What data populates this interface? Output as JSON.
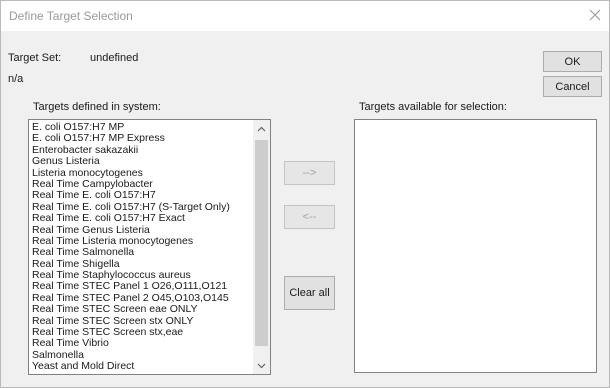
{
  "dialog": {
    "title": "Define Target Selection",
    "close_icon": "close-icon"
  },
  "target_set": {
    "label": "Target Set:",
    "value": "undefined",
    "description": "n/a"
  },
  "buttons": {
    "ok": "OK",
    "cancel": "Cancel",
    "add": "-->",
    "remove": "<--",
    "clear_all": "Clear all"
  },
  "system_list": {
    "heading": "Targets defined in system:",
    "items": [
      "E. coli O157:H7 MP",
      "E. coli O157:H7 MP Express",
      "Enterobacter sakazakii",
      "Genus Listeria",
      "Listeria monocytogenes",
      "Real Time Campylobacter",
      "Real Time E. coli O157:H7",
      "Real Time E. coli O157:H7 (S-Target Only)",
      "Real Time E. coli O157:H7 Exact",
      "Real Time Genus Listeria",
      "Real Time Listeria monocytogenes",
      "Real Time Salmonella",
      "Real Time Shigella",
      "Real Time Staphylococcus aureus",
      "Real Time STEC Panel 1 O26,O111,O121",
      "Real Time STEC Panel 2 O45,O103,O145",
      "Real Time STEC Screen eae ONLY",
      "Real Time STEC Screen stx ONLY",
      "Real Time STEC Screen stx,eae",
      "Real Time Vibrio",
      "Salmonella",
      "Yeast and Mold Direct"
    ],
    "scroll_up_icon": "chevron-up-icon",
    "scroll_down_icon": "chevron-down-icon"
  },
  "available_list": {
    "heading": "Targets available for selection:",
    "items": []
  },
  "colors": {
    "background": "#f0f0f0",
    "title_text": "#9a9a9a",
    "button_face": "#e1e1e1",
    "disabled_text": "#a0a0a0"
  }
}
